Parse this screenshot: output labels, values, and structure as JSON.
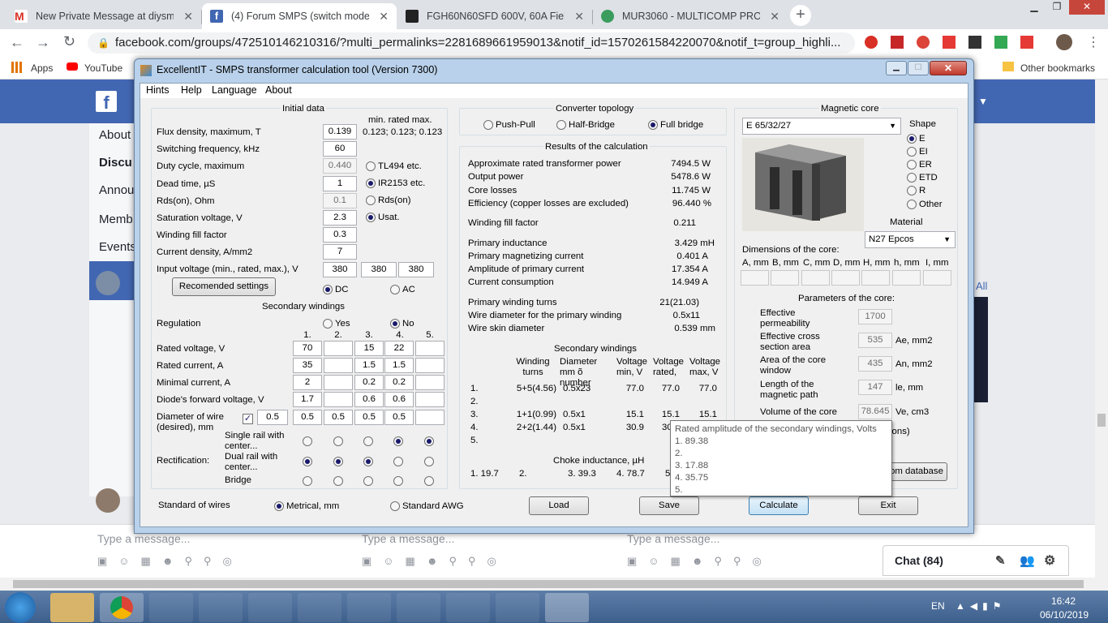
{
  "browser": {
    "tabs": [
      {
        "title": "New Private Message at diysmps"
      },
      {
        "title": "(4) Forum SMPS (switch mode po"
      },
      {
        "title": "FGH60N60SFD 600V, 60A Field St"
      },
      {
        "title": "MUR3060 - MULTICOMP PRO - R"
      }
    ],
    "url": "facebook.com/groups/472510146210316/?multi_permalinks=2281689661959013&notif_id=1570261584220070&notif_t=group_highli...",
    "bookmarks": {
      "apps": "Apps",
      "youtube": "YouTube",
      "other": "Other bookmarks"
    }
  },
  "facebook": {
    "nav": [
      "About",
      "Discu",
      "Annou",
      "Memb",
      "Events"
    ],
    "type_message": "Type a message...",
    "chat": "Chat (84)",
    "side_right": [
      "All"
    ]
  },
  "dialog": {
    "title": "ExcellentIT - SMPS transformer calculation tool (Version 7300)",
    "menu": [
      "Hints",
      "Help",
      "Language",
      "About"
    ],
    "initial": {
      "header": "Initial data",
      "minratedmax": "min.   rated   max.",
      "flux_label": "Flux density, maximum, T",
      "flux_value": "0.139",
      "flux_range": "0.123; 0.123; 0.123",
      "freq_label": "Switching frequency, kHz",
      "freq_value": "60",
      "duty_label": "Duty cycle, maximum",
      "duty_value": "0.440",
      "dead_label": "Dead time, µS",
      "dead_value": "1",
      "rds_label": "Rds(on), Ohm",
      "rds_value": "0.1",
      "sat_label": "Saturation voltage, V",
      "sat_value": "2.3",
      "fill_label": "Winding fill factor",
      "fill_value": "0.3",
      "cd_label": "Current density, A/mm2",
      "cd_value": "7",
      "vin_label": "Input voltage (min., rated, max.), V",
      "vin_values": [
        "380",
        "380",
        "380"
      ],
      "opt_tl494": "TL494 etc.",
      "opt_ir2153": "IR2153 etc.",
      "opt_rds": "Rds(on)",
      "opt_usat": "Usat.",
      "recommended": "Recomended settings",
      "dc": "DC",
      "ac": "AC"
    },
    "secondary": {
      "header": "Secondary windings",
      "regulation": "Regulation",
      "yes": "Yes",
      "no": "No",
      "cols": [
        "1.",
        "2.",
        "3.",
        "4.",
        "5."
      ],
      "rated_v_label": "Rated voltage, V",
      "rated_v": [
        "70",
        "",
        "15",
        "22",
        ""
      ],
      "rated_i_label": "Rated current, A",
      "rated_i": [
        "35",
        "",
        "1.5",
        "1.5",
        ""
      ],
      "min_i_label": "Minimal current, A",
      "min_i": [
        "2",
        "",
        "0.2",
        "0.2",
        ""
      ],
      "diode_label": "Diode's forward voltage, V",
      "diode": [
        "1.7",
        "",
        "0.6",
        "0.6",
        ""
      ],
      "wire_label1": "Diameter of wire",
      "wire_label2": "(desired), mm",
      "wire_check": "✓",
      "wire_main": "0.5",
      "wire": [
        "0.5",
        "0.5",
        "0.5",
        "0.5",
        ""
      ],
      "rect_label": "Rectification:",
      "single1": "Single rail with",
      "single2": "center...",
      "dual1": "Dual rail with",
      "dual2": "center...",
      "bridge": "Bridge"
    },
    "topology": {
      "header": "Converter topology",
      "options": [
        "Push-Pull",
        "Half-Bridge",
        "Full bridge"
      ]
    },
    "results": {
      "header": "Results of the calculation",
      "rows": [
        {
          "label": "Approximate rated transformer power",
          "value": "7494.5 W"
        },
        {
          "label": "Output power",
          "value": "5478.6 W"
        },
        {
          "label": "Core losses",
          "value": "11.745 W"
        },
        {
          "label": "Efficiency (copper losses are excluded)",
          "value": "96.440 %"
        },
        {
          "label": "Winding fill factor",
          "value": "0.211"
        },
        {
          "label": "Primary inductance",
          "value": "3.429 mH"
        },
        {
          "label": "Primary magnetizing current",
          "value": "0.401 A"
        },
        {
          "label": "Amplitude of primary current",
          "value": "17.354 A"
        },
        {
          "label": "Current consumption",
          "value": "14.949 A"
        },
        {
          "label": "Primary winding turns",
          "value": "21(21.03)"
        },
        {
          "label": "Wire diameter for the primary winding",
          "value": "0.5x11"
        },
        {
          "label": "Wire skin diameter",
          "value": "0.539 mm"
        }
      ],
      "sec_header": "Secondary windings",
      "sec_cols": [
        "Winding turns",
        "Diameter mm õ number",
        "Voltage min, V",
        "Voltage rated,",
        "Voltage max, V"
      ],
      "sec_rows": [
        {
          "n": "1.",
          "turns": "5+5(4.56)",
          "dia": "0.5x23",
          "vmin": "77.0",
          "vrat": "77.0",
          "vmax": "77.0"
        },
        {
          "n": "2.",
          "turns": "",
          "dia": "",
          "vmin": "",
          "vrat": "",
          "vmax": ""
        },
        {
          "n": "3.",
          "turns": "1+1(0.99)",
          "dia": "0.5x1",
          "vmin": "15.1",
          "vrat": "15.1",
          "vmax": "15.1"
        },
        {
          "n": "4.",
          "turns": "2+2(1.44)",
          "dia": "0.5x1",
          "vmin": "30.9",
          "vrat": "30",
          "vmax": ""
        },
        {
          "n": "5.",
          "turns": "",
          "dia": "",
          "vmin": "",
          "vrat": "",
          "vmax": ""
        }
      ],
      "choke_header": "Choke inductance, µH",
      "choke": [
        "1. 19.7",
        "2.",
        "3. 39.3",
        "4. 78.7",
        "5"
      ]
    },
    "core": {
      "header": "Magnetic core",
      "selected": "E 65/32/27",
      "shape_label": "Shape",
      "shapes": [
        "E",
        "EI",
        "ER",
        "ETD",
        "R",
        "Other"
      ],
      "material_label": "Material",
      "material": "N27 Epcos",
      "dims_label": "Dimensions of the core:",
      "dims": [
        "A, mm",
        "B, mm",
        "C, mm",
        "D, mm",
        "H, mm",
        "h, mm",
        "I, mm"
      ],
      "params_header": "Parameters of the core:",
      "params": [
        {
          "l1": "Effective",
          "l2": "permeability",
          "value": "1700",
          "unit": ""
        },
        {
          "l1": "Effective cross",
          "l2": "section area",
          "value": "535",
          "unit": "Ae, mm2"
        },
        {
          "l1": "Area of the core",
          "l2": "window",
          "value": "435",
          "unit": "An, mm2"
        },
        {
          "l1": "Length of the",
          "l2": "magnetic path",
          "value": "147",
          "unit": "le, mm"
        },
        {
          "l1": "Volume of the core",
          "l2": "",
          "value": "78.645",
          "unit": "Ve, cm3"
        }
      ],
      "ions": "ions)",
      "from_db": "om database"
    },
    "bottom": {
      "standard": "Standard of wires",
      "metrical": "Metrical, mm",
      "awg": "Standard AWG",
      "load": "Load",
      "save": "Save",
      "calculate": "Calculate",
      "exit": "Exit"
    },
    "tooltip": {
      "title": "Rated amplitude of the secondary windings, Volts",
      "lines": [
        "1. 89.38",
        "2.",
        "3. 17.88",
        "4. 35.75",
        "5."
      ]
    }
  },
  "taskbar": {
    "lang": "EN",
    "time": "16:42",
    "date": "06/10/2019"
  }
}
